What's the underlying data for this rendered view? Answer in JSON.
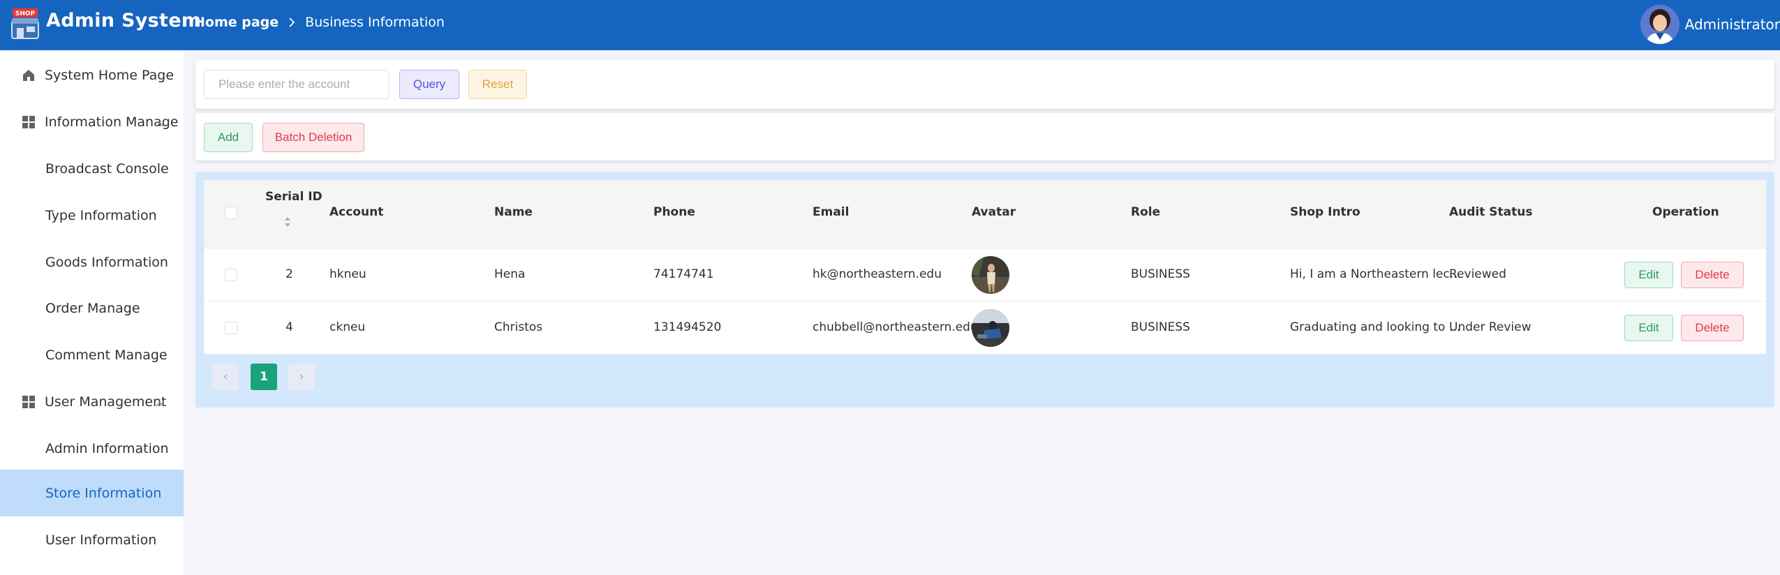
{
  "header": {
    "logo_badge": "SHOP",
    "app_title": "Admin System",
    "breadcrumb": {
      "home": "Home page",
      "current": "Business Information"
    },
    "user": {
      "name": "Administrator"
    }
  },
  "sidebar": {
    "items": [
      {
        "label": "System Home Page",
        "icon": "home-icon"
      },
      {
        "label": "Information Manage",
        "icon": "grid-icon",
        "expanded": true
      },
      {
        "label": "Broadcast Console"
      },
      {
        "label": "Type Information"
      },
      {
        "label": "Goods Information"
      },
      {
        "label": "Order Manage"
      },
      {
        "label": "Comment Manage"
      },
      {
        "label": "User Management",
        "icon": "grid-icon",
        "expanded": true
      },
      {
        "label": "Admin Information"
      },
      {
        "label": "Store Information",
        "active": true
      },
      {
        "label": "User Information"
      }
    ]
  },
  "search": {
    "placeholder": "Please enter the account",
    "value": "",
    "query_label": "Query",
    "reset_label": "Reset"
  },
  "actions": {
    "add_label": "Add",
    "batch_delete_label": "Batch Deletion"
  },
  "table": {
    "columns": [
      "Serial ID",
      "Account",
      "Name",
      "Phone",
      "Email",
      "Avatar",
      "Role",
      "Shop Intro",
      "Audit Status",
      "Operation"
    ],
    "rows": [
      {
        "id": "2",
        "account": "hkneu",
        "name": "Hena",
        "phone": "74174741",
        "email": "hk@northeastern.edu",
        "role": "BUSINESS",
        "intro": "Hi, I am a Northeastern lec...",
        "status": "Reviewed"
      },
      {
        "id": "4",
        "account": "ckneu",
        "name": "Christos",
        "phone": "131494520",
        "email": "chubbell@northeastern.edu",
        "role": "BUSINESS",
        "intro": "Graduating and looking to ...",
        "status": "Under Review"
      }
    ],
    "edit_label": "Edit",
    "delete_label": "Delete"
  },
  "pagination": {
    "current_page": "1",
    "prev": "‹",
    "next": "›"
  },
  "colors": {
    "header": "#1565c0",
    "active_menu": "#bfdcfb",
    "table_area": "#d3e8fc",
    "page_active": "#1aa37a"
  }
}
